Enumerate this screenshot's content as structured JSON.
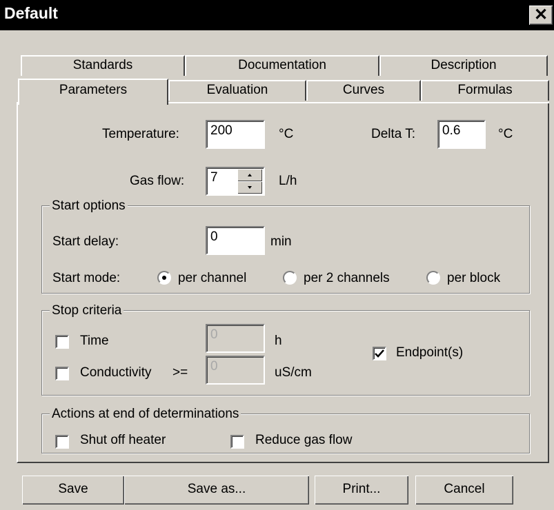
{
  "window": {
    "title": "Default",
    "close_glyph": "✕"
  },
  "tabs_back": [
    "Standards",
    "Documentation",
    "Description"
  ],
  "tabs_front": [
    "Parameters",
    "Evaluation",
    "Curves",
    "Formulas"
  ],
  "params": {
    "temperature_label": "Temperature:",
    "temperature_value": "200",
    "temperature_unit": "°C",
    "delta_label": "Delta T:",
    "delta_value": "0.6",
    "delta_unit": "°C",
    "gasflow_label": "Gas flow:",
    "gasflow_value": "7",
    "gasflow_unit": "L/h"
  },
  "start_options": {
    "legend": "Start options",
    "delay_label": "Start delay:",
    "delay_value": "0",
    "delay_unit": "min",
    "mode_label": "Start mode:",
    "modes": [
      "per channel",
      "per 2 channels",
      "per block"
    ],
    "selected_mode": "per channel"
  },
  "stop_criteria": {
    "legend": "Stop criteria",
    "time_label": "Time",
    "time_value": "0",
    "time_unit": "h",
    "time_checked": false,
    "cond_label": "Conductivity",
    "cond_op": ">=",
    "cond_value": "0",
    "cond_unit": "uS/cm",
    "cond_checked": false,
    "endpoint_label": "Endpoint(s)",
    "endpoint_checked": true
  },
  "actions": {
    "legend": "Actions at end of determinations",
    "shutoff_label": "Shut off heater",
    "shutoff_checked": false,
    "reduce_label": "Reduce gas flow",
    "reduce_checked": false
  },
  "buttons": {
    "save": "Save",
    "save_as": "Save as...",
    "print": "Print...",
    "cancel": "Cancel"
  },
  "colors": {
    "face": "#d4d0c8",
    "titlebar": "#000000",
    "field": "#ffffff",
    "disabled_text": "#a8a8a8"
  }
}
